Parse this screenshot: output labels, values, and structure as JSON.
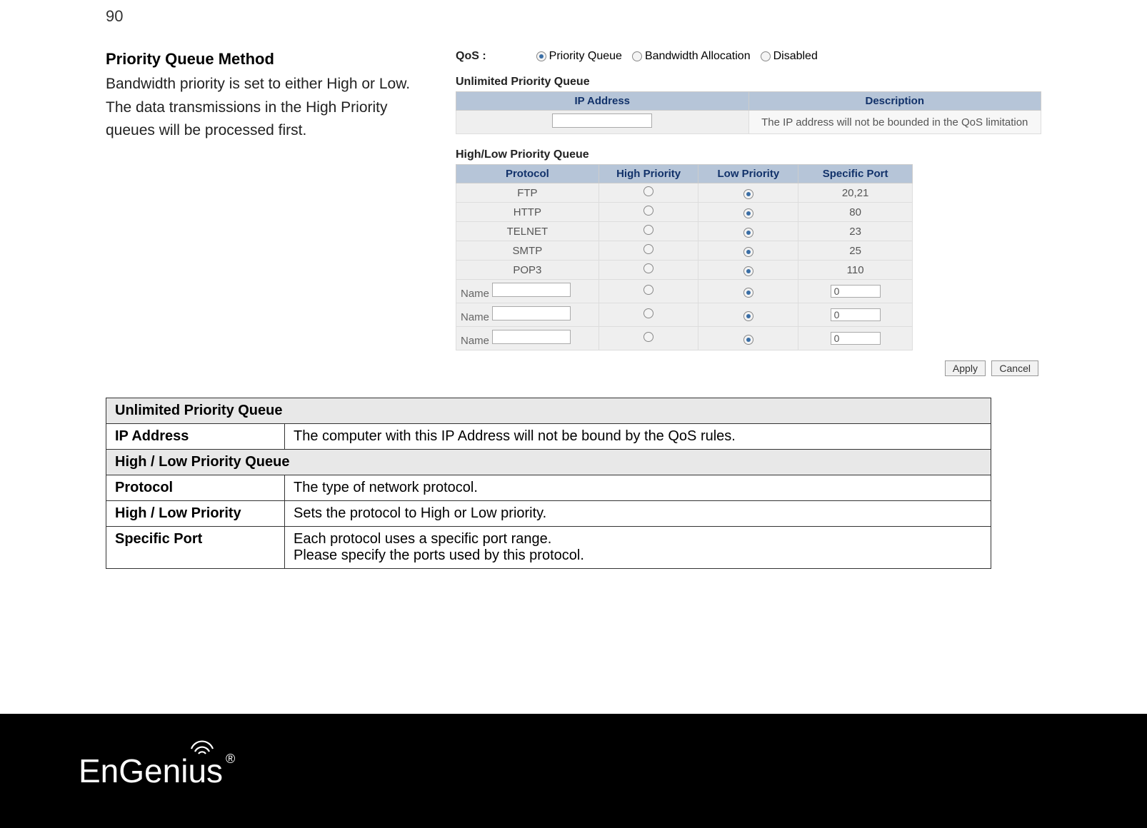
{
  "pageNumber": "90",
  "left": {
    "heading": "Priority Queue Method",
    "para": "Bandwidth priority is set to either High or Low. The data transmissions in the High Priority queues will be processed first."
  },
  "shot": {
    "qosLabel": "QoS :",
    "opts": [
      "Priority Queue",
      "Bandwidth Allocation",
      "Disabled"
    ],
    "upq": {
      "title": "Unlimited Priority Queue",
      "headers": [
        "IP Address",
        "Description"
      ],
      "desc": "The IP address will not be bounded in the QoS limitation"
    },
    "hlq": {
      "title": "High/Low Priority Queue",
      "headers": [
        "Protocol",
        "High Priority",
        "Low Priority",
        "Specific Port"
      ],
      "rows": [
        {
          "name": "FTP",
          "port": "20,21",
          "custom": false
        },
        {
          "name": "HTTP",
          "port": "80",
          "custom": false
        },
        {
          "name": "TELNET",
          "port": "23",
          "custom": false
        },
        {
          "name": "SMTP",
          "port": "25",
          "custom": false
        },
        {
          "name": "POP3",
          "port": "110",
          "custom": false
        },
        {
          "name": "Name",
          "port": "0",
          "custom": true
        },
        {
          "name": "Name",
          "port": "0",
          "custom": true
        },
        {
          "name": "Name",
          "port": "0",
          "custom": true
        }
      ]
    },
    "btnApply": "Apply",
    "btnCancel": "Cancel"
  },
  "descTable": {
    "sect1": "Unlimited Priority Queue",
    "r1": {
      "label": "IP Address",
      "val": "The computer with this IP Address will not be bound by the QoS rules."
    },
    "sect2": "High / Low Priority Queue",
    "r2": {
      "label": "Protocol",
      "val": "The type of network protocol."
    },
    "r3": {
      "label": "High / Low Priority",
      "val": "Sets the protocol to High or Low priority."
    },
    "r4": {
      "label": "Specific Port",
      "val1": "Each protocol uses a specific port range.",
      "val2": "Please specify the ports used by this protocol."
    }
  },
  "logo": {
    "part1": "EnGen",
    "part2": "ius",
    "reg": "®"
  }
}
